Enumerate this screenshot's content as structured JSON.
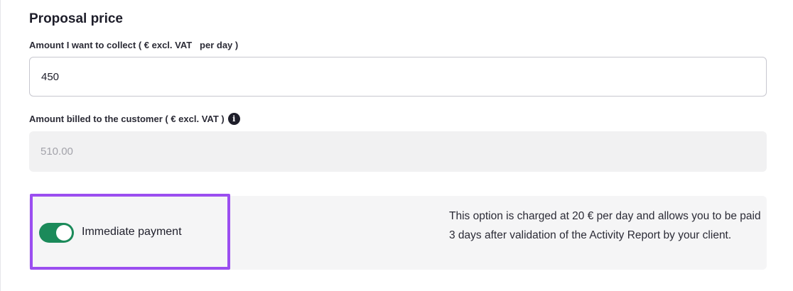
{
  "section": {
    "title": "Proposal price"
  },
  "amount_to_collect": {
    "label": "Amount I want to collect ( € excl. VAT   per day )",
    "value": "450"
  },
  "amount_billed": {
    "label": "Amount billed to the customer ( € excl. VAT )",
    "value": "510.00",
    "info_icon": "info-icon"
  },
  "immediate_payment": {
    "label": "Immediate payment",
    "enabled": true,
    "toggle_color": "#1b8a5a",
    "highlight_color": "#9b4ef0",
    "description": "This option is charged at 20 € per day and allows you to be paid 3 days after validation of the Activity Report by your client."
  }
}
